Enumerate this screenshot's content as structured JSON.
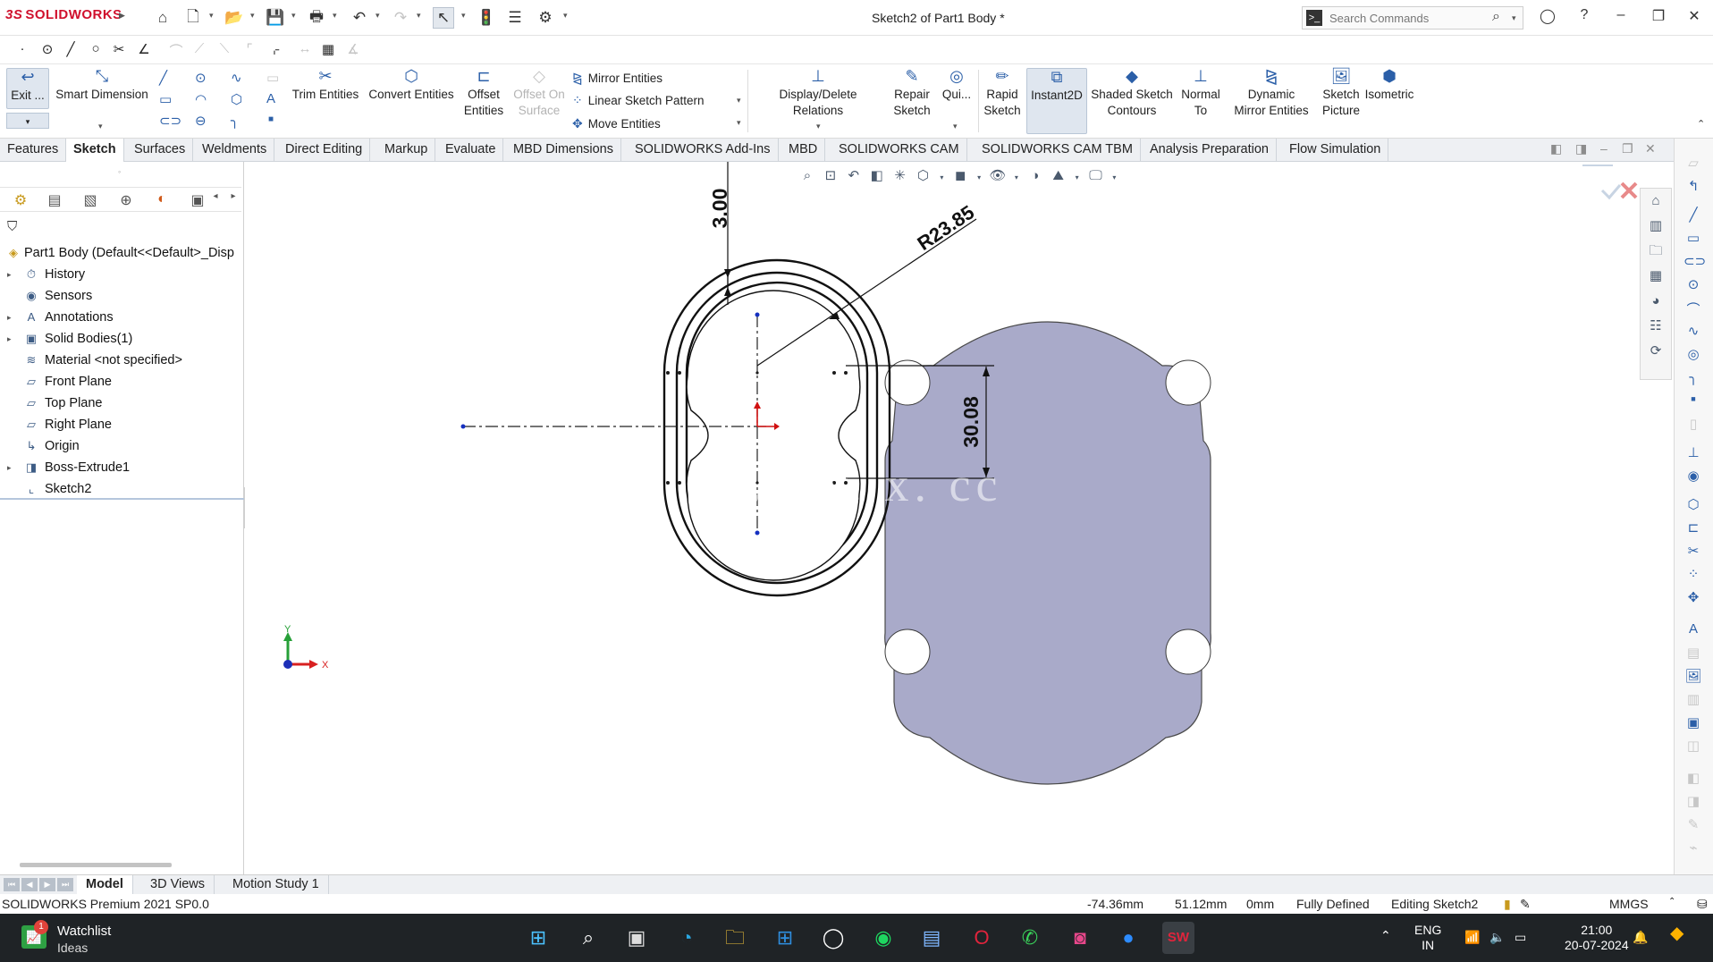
{
  "titlebar": {
    "brand_ds": "3S",
    "brand_name": "SOLIDWORKS",
    "document_title": "Sketch2 of Part1 Body *",
    "search_placeholder": "Search Commands"
  },
  "ribbon": {
    "exit": "Exit ...",
    "smart_dimension": "Smart Dimension",
    "trim_entities": "Trim Entities",
    "convert_entities": "Convert Entities",
    "offset_entities_1": "Offset",
    "offset_entities_2": "Entities",
    "offset_on_surface_1": "Offset On",
    "offset_on_surface_2": "Surface",
    "mirror_entities": "Mirror Entities",
    "linear_sketch_pattern": "Linear Sketch Pattern",
    "move_entities": "Move Entities",
    "display_delete_relations": "Display/Delete Relations",
    "repair_sketch_1": "Repair",
    "repair_sketch_2": "Sketch",
    "quick_snaps": "Qui...",
    "rapid_sketch_1": "Rapid",
    "rapid_sketch_2": "Sketch",
    "instant2d": "Instant2D",
    "shaded_contours_1": "Shaded Sketch",
    "shaded_contours_2": "Contours",
    "normal_to_1": "Normal",
    "normal_to_2": "To",
    "dynamic_mirror_1": "Dynamic",
    "dynamic_mirror_2": "Mirror Entities",
    "sketch_picture_1": "Sketch",
    "sketch_picture_2": "Picture",
    "isometric": "Isometric"
  },
  "tabs": [
    "Features",
    "Sketch",
    "Surfaces",
    "Weldments",
    "Direct Editing",
    "Markup",
    "Evaluate",
    "MBD Dimensions",
    "SOLIDWORKS Add-Ins",
    "MBD",
    "SOLIDWORKS CAM",
    "SOLIDWORKS CAM TBM",
    "Analysis Preparation",
    "Flow Simulation"
  ],
  "active_tab": "Sketch",
  "feature_tree": {
    "root": "Part1 Body  (Default<<Default>_Disp",
    "items": [
      {
        "label": "History",
        "icon": "history-icon",
        "expandable": true
      },
      {
        "label": "Sensors",
        "icon": "sensors-icon",
        "expandable": false
      },
      {
        "label": "Annotations",
        "icon": "annotations-icon",
        "expandable": true
      },
      {
        "label": "Solid Bodies(1)",
        "icon": "solid-bodies-icon",
        "expandable": true
      },
      {
        "label": "Material <not specified>",
        "icon": "material-icon",
        "expandable": false
      },
      {
        "label": "Front Plane",
        "icon": "plane-icon",
        "expandable": false
      },
      {
        "label": "Top Plane",
        "icon": "plane-icon",
        "expandable": false
      },
      {
        "label": "Right Plane",
        "icon": "plane-icon",
        "expandable": false
      },
      {
        "label": "Origin",
        "icon": "origin-icon",
        "expandable": false
      },
      {
        "label": "Boss-Extrude1",
        "icon": "extrude-icon",
        "expandable": true
      },
      {
        "label": "Sketch2",
        "icon": "sketch-icon",
        "expandable": false
      }
    ]
  },
  "drawing": {
    "dim_thickness": "3.00",
    "dim_radius": "R23.85",
    "dim_height": "30.08",
    "watermark": "www.    x. cc",
    "triad_y": "Y",
    "triad_x": "X",
    "part_color": "#a9aac9"
  },
  "bottom_tabs": [
    "Model",
    "3D Views",
    "Motion Study 1"
  ],
  "active_bottom_tab": "Model",
  "status": {
    "product": "SOLIDWORKS Premium 2021 SP0.0",
    "x": "-74.36mm",
    "y": "51.12mm",
    "z": "0mm",
    "sketch_state": "Fully Defined",
    "editing": "Editing Sketch2",
    "units": "MMGS"
  },
  "taskbar": {
    "widget_title": "Watchlist",
    "widget_subtitle": "Ideas",
    "widget_badge": "1",
    "lang_1": "ENG",
    "lang_2": "IN",
    "time": "21:00",
    "date": "20-07-2024"
  }
}
